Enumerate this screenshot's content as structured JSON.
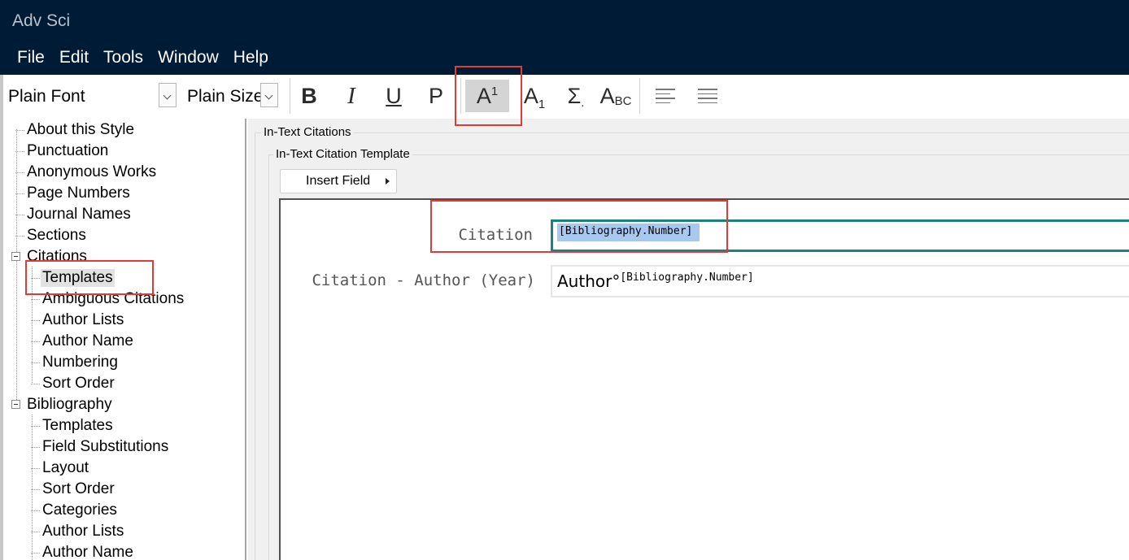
{
  "window": {
    "title": "Adv Sci"
  },
  "menu": [
    "File",
    "Edit",
    "Tools",
    "Window",
    "Help"
  ],
  "toolbar": {
    "font": "Plain Font",
    "size": "Plain Size",
    "bold": "B",
    "italic": "I",
    "underline": "U",
    "plain": "P",
    "superscript": {
      "main": "A",
      "mark": "1",
      "active": true
    },
    "subscript": {
      "main": "A",
      "mark": "1"
    },
    "symbol": {
      "main": "Σ",
      "mark": "."
    },
    "small_caps": {
      "main": "A",
      "mark": "BC"
    },
    "icons": [
      "bold-icon",
      "italic-icon",
      "underline-icon",
      "plain-icon",
      "superscript-icon",
      "subscript-icon",
      "symbol-icon",
      "small-caps-icon",
      "align-left-icon",
      "justify-icon"
    ]
  },
  "tree": {
    "items": [
      {
        "label": "About this Style",
        "level": 0
      },
      {
        "label": "Punctuation",
        "level": 0
      },
      {
        "label": "Anonymous Works",
        "level": 0
      },
      {
        "label": "Page Numbers",
        "level": 0
      },
      {
        "label": "Journal Names",
        "level": 0
      },
      {
        "label": "Sections",
        "level": 0
      },
      {
        "label": "Citations",
        "level": 0,
        "expanded": true
      },
      {
        "label": "Templates",
        "level": 1,
        "selected": true
      },
      {
        "label": "Ambiguous Citations",
        "level": 1
      },
      {
        "label": "Author Lists",
        "level": 1
      },
      {
        "label": "Author Name",
        "level": 1
      },
      {
        "label": "Numbering",
        "level": 1
      },
      {
        "label": "Sort Order",
        "level": 1
      },
      {
        "label": "Bibliography",
        "level": 0,
        "expanded": true
      },
      {
        "label": "Templates",
        "level": 1
      },
      {
        "label": "Field Substitutions",
        "level": 1
      },
      {
        "label": "Layout",
        "level": 1
      },
      {
        "label": "Sort Order",
        "level": 1
      },
      {
        "label": "Categories",
        "level": 1
      },
      {
        "label": "Author Lists",
        "level": 1
      },
      {
        "label": "Author Name",
        "level": 1
      }
    ]
  },
  "panel": {
    "group_title": "In-Text Citations",
    "subgroup_title": "In-Text Citation Template",
    "insert_field": "Insert Field",
    "templates": [
      {
        "label": "Citation",
        "value": "[Bibliography.Number]",
        "focused": true
      },
      {
        "label": "Citation - Author (Year)",
        "value_prefix": "Author°",
        "value": "[Bibliography.Number]"
      }
    ]
  },
  "colors": {
    "titlebar": "#001b35",
    "focus_border": "#1c8183",
    "selection": "#a7c9ef",
    "highlight_box": "#e53935"
  }
}
